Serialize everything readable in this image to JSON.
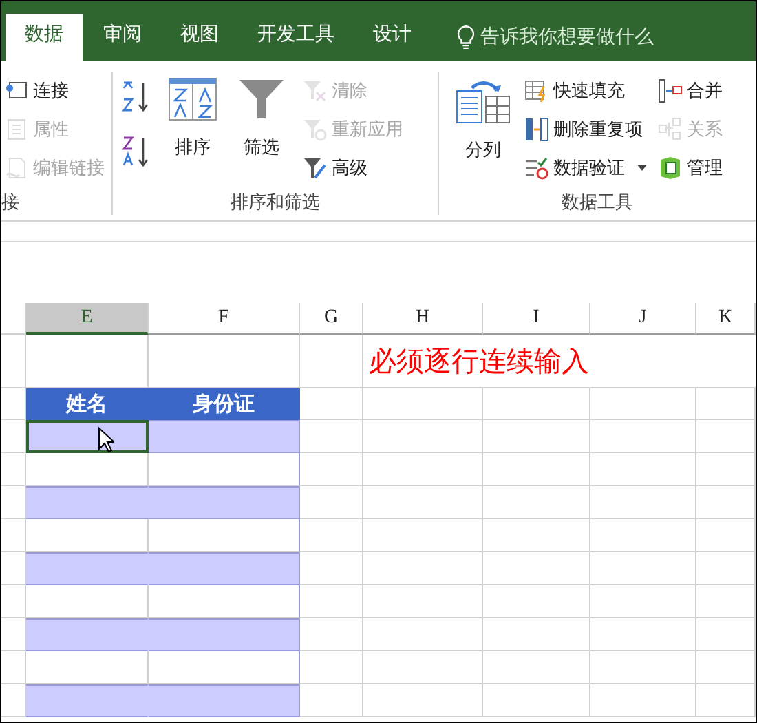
{
  "tabs": [
    {
      "label": "数据",
      "selected": true
    },
    {
      "label": "审阅",
      "selected": false
    },
    {
      "label": "视图",
      "selected": false
    },
    {
      "label": "开发工具",
      "selected": false
    },
    {
      "label": "设计",
      "selected": false
    }
  ],
  "tell_me": {
    "placeholder": "告诉我你想要做什么"
  },
  "ribbon": {
    "groups": [
      {
        "label": "接",
        "items": [
          {
            "kind": "small",
            "label": "连接",
            "disabled": false
          },
          {
            "kind": "small",
            "label": "属性",
            "disabled": true
          },
          {
            "kind": "small",
            "label": "编辑链接",
            "disabled": true
          }
        ]
      },
      {
        "label": "排序和筛选",
        "items": [
          {
            "kind": "sortpair"
          },
          {
            "kind": "large",
            "label": "排序",
            "disabled": false
          },
          {
            "kind": "large",
            "label": "筛选",
            "disabled": false
          },
          {
            "kind": "small",
            "label": "清除",
            "disabled": true
          },
          {
            "kind": "small",
            "label": "重新应用",
            "disabled": true
          },
          {
            "kind": "small",
            "label": "高级",
            "disabled": false
          }
        ]
      },
      {
        "label": "数据工具",
        "items": [
          {
            "kind": "large",
            "label": "分列",
            "disabled": false
          },
          {
            "kind": "small",
            "label": "快速填充",
            "disabled": false
          },
          {
            "kind": "small",
            "label": "删除重复项",
            "disabled": false
          },
          {
            "kind": "small",
            "label": "数据验证",
            "disabled": false,
            "dropdown": true
          },
          {
            "kind": "small",
            "label": "合并",
            "disabled": false
          },
          {
            "kind": "small",
            "label": "关系",
            "disabled": true
          },
          {
            "kind": "small",
            "label": "管理",
            "disabled": false
          }
        ]
      }
    ]
  },
  "sheet": {
    "columns": [
      {
        "label": "E",
        "selected": true
      },
      {
        "label": "F",
        "selected": false
      },
      {
        "label": "G",
        "selected": false
      },
      {
        "label": "H",
        "selected": false
      },
      {
        "label": "I",
        "selected": false
      },
      {
        "label": "J",
        "selected": false
      },
      {
        "label": "K",
        "selected": false
      }
    ],
    "note": "必须逐行连续输入",
    "table_header": [
      "姓名",
      "身份证"
    ],
    "rows": [
      {
        "shaded": true,
        "selected": true
      },
      {
        "shaded": false,
        "selected": false
      },
      {
        "shaded": true,
        "selected": false
      },
      {
        "shaded": false,
        "selected": false
      },
      {
        "shaded": true,
        "selected": false
      },
      {
        "shaded": false,
        "selected": false
      },
      {
        "shaded": true,
        "selected": false
      },
      {
        "shaded": false,
        "selected": false
      },
      {
        "shaded": true,
        "selected": false
      }
    ]
  }
}
